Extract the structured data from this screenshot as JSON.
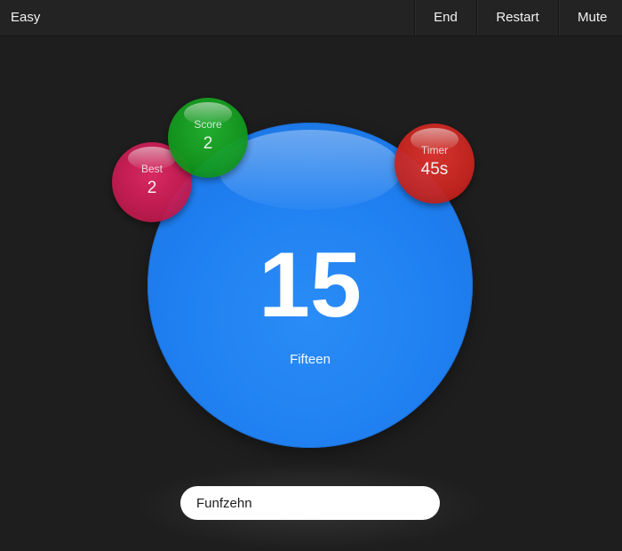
{
  "header": {
    "difficulty": "Easy",
    "buttons": {
      "end": "End",
      "restart": "Restart",
      "mute": "Mute"
    }
  },
  "game": {
    "number": "15",
    "word": "Fifteen",
    "colors": {
      "main_bubble": "#1f7ff0",
      "best_bubble": "#c41b52",
      "score_bubble": "#139a1e",
      "timer_bubble": "#c92520"
    }
  },
  "stats": {
    "best": {
      "label": "Best",
      "value": "2"
    },
    "score": {
      "label": "Score",
      "value": "2"
    },
    "timer": {
      "label": "Timer",
      "value": "45s"
    }
  },
  "answer": {
    "value": "Funfzehn"
  }
}
